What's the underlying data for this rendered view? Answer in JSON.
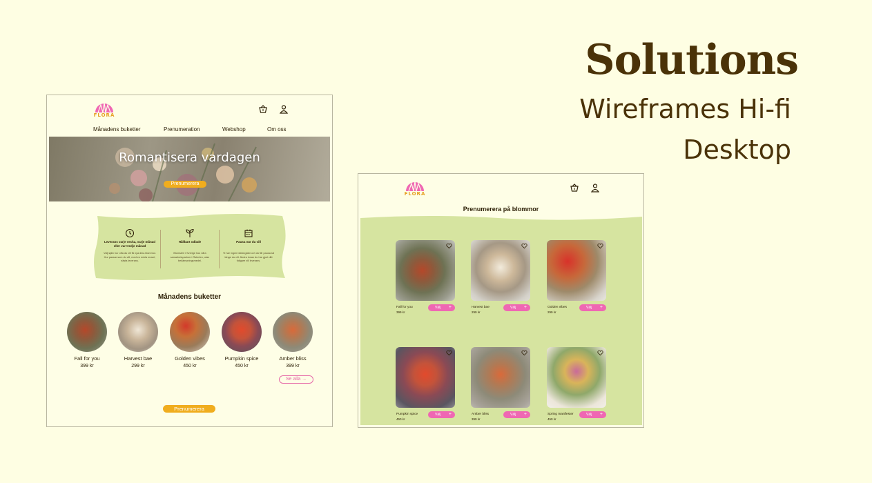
{
  "header": {
    "title": "Solutions",
    "subtitle_line1": "Wireframes Hi-fi",
    "subtitle_line2": "Desktop"
  },
  "brand": {
    "logo_text": "FLORA"
  },
  "home_page": {
    "nav": [
      "Månadens buketter",
      "Prenumeration",
      "Webshop",
      "Om oss"
    ],
    "hero": {
      "headline": "Romantisera vardagen",
      "cta": "Prenumerera"
    },
    "features": [
      {
        "icon": "clock-icon",
        "title": "Leverans varje vecka, varje månad eller var tredje månad",
        "text": "Välj själv hur ofta du vill få nya dina blommor. Hur passar som du vill, med en enkla mosel, nästa leverans."
      },
      {
        "icon": "sprout-icon",
        "title": "Hållbart odlade",
        "text": "Blomsterl i Sverige hos våra samarbetspartner i Österlen, utan bekämpningsmedel."
      },
      {
        "icon": "calendar-icon",
        "title": "Pausa när du vill",
        "text": "Vi har ingen bidningstid och du får pausa så länge du vill. Ändra innan du har gjort ditt tidigare vill leverans."
      }
    ],
    "section_title": "Månadens buketter",
    "bouquets": [
      {
        "name": "Fall for you",
        "price": "399 kr"
      },
      {
        "name": "Harvest bae",
        "price": "299 kr"
      },
      {
        "name": "Golden vibes",
        "price": "450 kr"
      },
      {
        "name": "Pumpkin spice",
        "price": "450 kr"
      },
      {
        "name": "Amber bliss",
        "price": "399 kr"
      }
    ],
    "see_all": "Se alla",
    "bottom_cta": "Prenumerera"
  },
  "subscribe_page": {
    "title": "Prenumerera på blommor",
    "choose_label": "Välj",
    "products": [
      {
        "name": "Fall for you",
        "price": "399 kr"
      },
      {
        "name": "Harvest bae",
        "price": "299 kr"
      },
      {
        "name": "Golden vibes",
        "price": "299 kr"
      },
      {
        "name": "Pumpkin spice",
        "price": "450 kr"
      },
      {
        "name": "Amber bliss",
        "price": "399 kr"
      },
      {
        "name": "Spring manifester",
        "price": "450 kr"
      }
    ]
  },
  "colors": {
    "background": "#fefee3",
    "brown_text": "#4a3208",
    "accent_orange": "#f0ad1e",
    "accent_pink": "#ef67b3",
    "panel_green": "#d6e4a0"
  }
}
